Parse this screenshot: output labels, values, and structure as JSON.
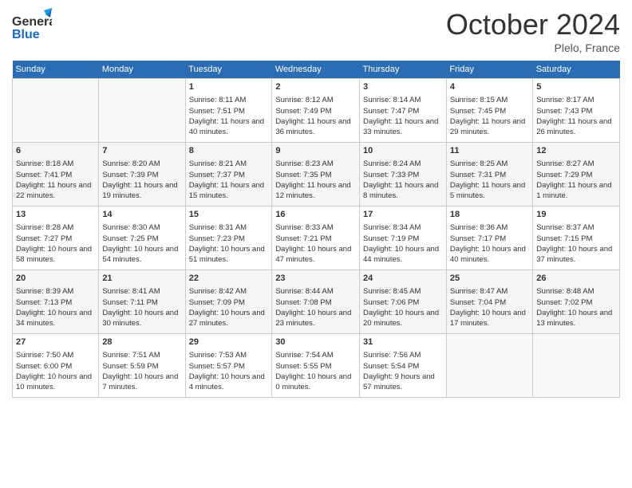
{
  "header": {
    "logo_general": "General",
    "logo_blue": "Blue",
    "month": "October 2024",
    "location": "Plelo, France"
  },
  "days_of_week": [
    "Sunday",
    "Monday",
    "Tuesday",
    "Wednesday",
    "Thursday",
    "Friday",
    "Saturday"
  ],
  "weeks": [
    [
      {
        "day": "",
        "sunrise": "",
        "sunset": "",
        "daylight": ""
      },
      {
        "day": "",
        "sunrise": "",
        "sunset": "",
        "daylight": ""
      },
      {
        "day": "1",
        "sunrise": "Sunrise: 8:11 AM",
        "sunset": "Sunset: 7:51 PM",
        "daylight": "Daylight: 11 hours and 40 minutes."
      },
      {
        "day": "2",
        "sunrise": "Sunrise: 8:12 AM",
        "sunset": "Sunset: 7:49 PM",
        "daylight": "Daylight: 11 hours and 36 minutes."
      },
      {
        "day": "3",
        "sunrise": "Sunrise: 8:14 AM",
        "sunset": "Sunset: 7:47 PM",
        "daylight": "Daylight: 11 hours and 33 minutes."
      },
      {
        "day": "4",
        "sunrise": "Sunrise: 8:15 AM",
        "sunset": "Sunset: 7:45 PM",
        "daylight": "Daylight: 11 hours and 29 minutes."
      },
      {
        "day": "5",
        "sunrise": "Sunrise: 8:17 AM",
        "sunset": "Sunset: 7:43 PM",
        "daylight": "Daylight: 11 hours and 26 minutes."
      }
    ],
    [
      {
        "day": "6",
        "sunrise": "Sunrise: 8:18 AM",
        "sunset": "Sunset: 7:41 PM",
        "daylight": "Daylight: 11 hours and 22 minutes."
      },
      {
        "day": "7",
        "sunrise": "Sunrise: 8:20 AM",
        "sunset": "Sunset: 7:39 PM",
        "daylight": "Daylight: 11 hours and 19 minutes."
      },
      {
        "day": "8",
        "sunrise": "Sunrise: 8:21 AM",
        "sunset": "Sunset: 7:37 PM",
        "daylight": "Daylight: 11 hours and 15 minutes."
      },
      {
        "day": "9",
        "sunrise": "Sunrise: 8:23 AM",
        "sunset": "Sunset: 7:35 PM",
        "daylight": "Daylight: 11 hours and 12 minutes."
      },
      {
        "day": "10",
        "sunrise": "Sunrise: 8:24 AM",
        "sunset": "Sunset: 7:33 PM",
        "daylight": "Daylight: 11 hours and 8 minutes."
      },
      {
        "day": "11",
        "sunrise": "Sunrise: 8:25 AM",
        "sunset": "Sunset: 7:31 PM",
        "daylight": "Daylight: 11 hours and 5 minutes."
      },
      {
        "day": "12",
        "sunrise": "Sunrise: 8:27 AM",
        "sunset": "Sunset: 7:29 PM",
        "daylight": "Daylight: 11 hours and 1 minute."
      }
    ],
    [
      {
        "day": "13",
        "sunrise": "Sunrise: 8:28 AM",
        "sunset": "Sunset: 7:27 PM",
        "daylight": "Daylight: 10 hours and 58 minutes."
      },
      {
        "day": "14",
        "sunrise": "Sunrise: 8:30 AM",
        "sunset": "Sunset: 7:25 PM",
        "daylight": "Daylight: 10 hours and 54 minutes."
      },
      {
        "day": "15",
        "sunrise": "Sunrise: 8:31 AM",
        "sunset": "Sunset: 7:23 PM",
        "daylight": "Daylight: 10 hours and 51 minutes."
      },
      {
        "day": "16",
        "sunrise": "Sunrise: 8:33 AM",
        "sunset": "Sunset: 7:21 PM",
        "daylight": "Daylight: 10 hours and 47 minutes."
      },
      {
        "day": "17",
        "sunrise": "Sunrise: 8:34 AM",
        "sunset": "Sunset: 7:19 PM",
        "daylight": "Daylight: 10 hours and 44 minutes."
      },
      {
        "day": "18",
        "sunrise": "Sunrise: 8:36 AM",
        "sunset": "Sunset: 7:17 PM",
        "daylight": "Daylight: 10 hours and 40 minutes."
      },
      {
        "day": "19",
        "sunrise": "Sunrise: 8:37 AM",
        "sunset": "Sunset: 7:15 PM",
        "daylight": "Daylight: 10 hours and 37 minutes."
      }
    ],
    [
      {
        "day": "20",
        "sunrise": "Sunrise: 8:39 AM",
        "sunset": "Sunset: 7:13 PM",
        "daylight": "Daylight: 10 hours and 34 minutes."
      },
      {
        "day": "21",
        "sunrise": "Sunrise: 8:41 AM",
        "sunset": "Sunset: 7:11 PM",
        "daylight": "Daylight: 10 hours and 30 minutes."
      },
      {
        "day": "22",
        "sunrise": "Sunrise: 8:42 AM",
        "sunset": "Sunset: 7:09 PM",
        "daylight": "Daylight: 10 hours and 27 minutes."
      },
      {
        "day": "23",
        "sunrise": "Sunrise: 8:44 AM",
        "sunset": "Sunset: 7:08 PM",
        "daylight": "Daylight: 10 hours and 23 minutes."
      },
      {
        "day": "24",
        "sunrise": "Sunrise: 8:45 AM",
        "sunset": "Sunset: 7:06 PM",
        "daylight": "Daylight: 10 hours and 20 minutes."
      },
      {
        "day": "25",
        "sunrise": "Sunrise: 8:47 AM",
        "sunset": "Sunset: 7:04 PM",
        "daylight": "Daylight: 10 hours and 17 minutes."
      },
      {
        "day": "26",
        "sunrise": "Sunrise: 8:48 AM",
        "sunset": "Sunset: 7:02 PM",
        "daylight": "Daylight: 10 hours and 13 minutes."
      }
    ],
    [
      {
        "day": "27",
        "sunrise": "Sunrise: 7:50 AM",
        "sunset": "Sunset: 6:00 PM",
        "daylight": "Daylight: 10 hours and 10 minutes."
      },
      {
        "day": "28",
        "sunrise": "Sunrise: 7:51 AM",
        "sunset": "Sunset: 5:59 PM",
        "daylight": "Daylight: 10 hours and 7 minutes."
      },
      {
        "day": "29",
        "sunrise": "Sunrise: 7:53 AM",
        "sunset": "Sunset: 5:57 PM",
        "daylight": "Daylight: 10 hours and 4 minutes."
      },
      {
        "day": "30",
        "sunrise": "Sunrise: 7:54 AM",
        "sunset": "Sunset: 5:55 PM",
        "daylight": "Daylight: 10 hours and 0 minutes."
      },
      {
        "day": "31",
        "sunrise": "Sunrise: 7:56 AM",
        "sunset": "Sunset: 5:54 PM",
        "daylight": "Daylight: 9 hours and 57 minutes."
      },
      {
        "day": "",
        "sunrise": "",
        "sunset": "",
        "daylight": ""
      },
      {
        "day": "",
        "sunrise": "",
        "sunset": "",
        "daylight": ""
      }
    ]
  ]
}
